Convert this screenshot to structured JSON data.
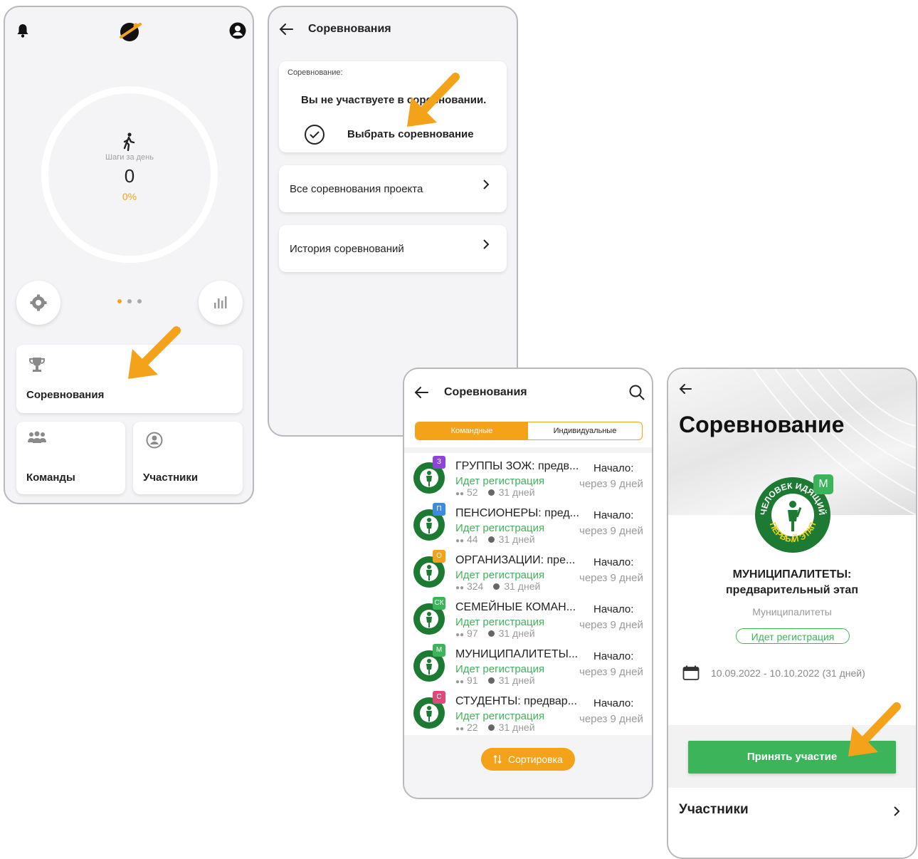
{
  "screen1": {
    "steps_label": "Шаги за день",
    "steps_value": "0",
    "steps_percent": "0%",
    "progress": 0,
    "tile_competitions": "Соревнования",
    "tile_teams": "Команды",
    "tile_participants": "Участники"
  },
  "screen2": {
    "title": "Соревнования",
    "card_label": "Соревнование:",
    "not_participating": "Вы не участвуете в соревновании.",
    "choose": "Выбрать соревнование",
    "all": "Все соревнования проекта",
    "history": "История соревнований"
  },
  "screen3": {
    "title": "Соревнования",
    "tab_team": "Командные",
    "tab_individual": "Индивидуальные",
    "sort": "Сортировка",
    "items": [
      {
        "title": "ГРУППЫ ЗОЖ: предв...",
        "badge": "З",
        "badge_color": "#8e44d8",
        "status": "Идет регистрация",
        "count": "52",
        "duration": "31 дней",
        "start_label": "Начало:",
        "start_when": "через 9 дней"
      },
      {
        "title": "ПЕНСИОНЕРЫ: пред...",
        "badge": "П",
        "badge_color": "#3d8be0",
        "status": "Идет регистрация",
        "count": "44",
        "duration": "31 дней",
        "start_label": "Начало:",
        "start_when": "через 9 дней"
      },
      {
        "title": "ОРГАНИЗАЦИИ: пре...",
        "badge": "О",
        "badge_color": "#f2a31b",
        "status": "Идет регистрация",
        "count": "324",
        "duration": "31 дней",
        "start_label": "Начало:",
        "start_when": "через 9 дней"
      },
      {
        "title": "СЕМЕЙНЫЕ КОМАН...",
        "badge": "СК",
        "badge_color": "#3cb55a",
        "status": "Идет регистрация",
        "count": "97",
        "duration": "31 дней",
        "start_label": "Начало:",
        "start_when": "через 9 дней"
      },
      {
        "title": "МУНИЦИПАЛИТЕТЫ...",
        "badge": "М",
        "badge_color": "#3cb55a",
        "status": "Идет регистрация",
        "count": "91",
        "duration": "31 дней",
        "start_label": "Начало:",
        "start_when": "через 9 дней"
      },
      {
        "title": "СТУДЕНТЫ: предвар...",
        "badge": "С",
        "badge_color": "#e0487a",
        "status": "Идет регистрация",
        "count": "22",
        "duration": "31 дней",
        "start_label": "Начало:",
        "start_when": "через 9 дней"
      }
    ]
  },
  "screen4": {
    "heading": "Соревнование",
    "badge": "М",
    "logo_top": "ЧЕЛОВЕК ИДЯЩИЙ",
    "logo_bottom": "ПЕРВЫЙ ЭТАП",
    "name_line1": "МУНИЦИПАЛИТЕТЫ:",
    "name_line2": "предварительный этап",
    "category": "Муниципалитеты",
    "status": "Идет регистрация",
    "dates": "10.09.2022 - 10.10.2022 (31 дней)",
    "join": "Принять участие",
    "participants": "Участники"
  },
  "colors": {
    "accent": "#f5a21b",
    "green": "#3cb55a",
    "dark_green": "#1c7a32"
  }
}
